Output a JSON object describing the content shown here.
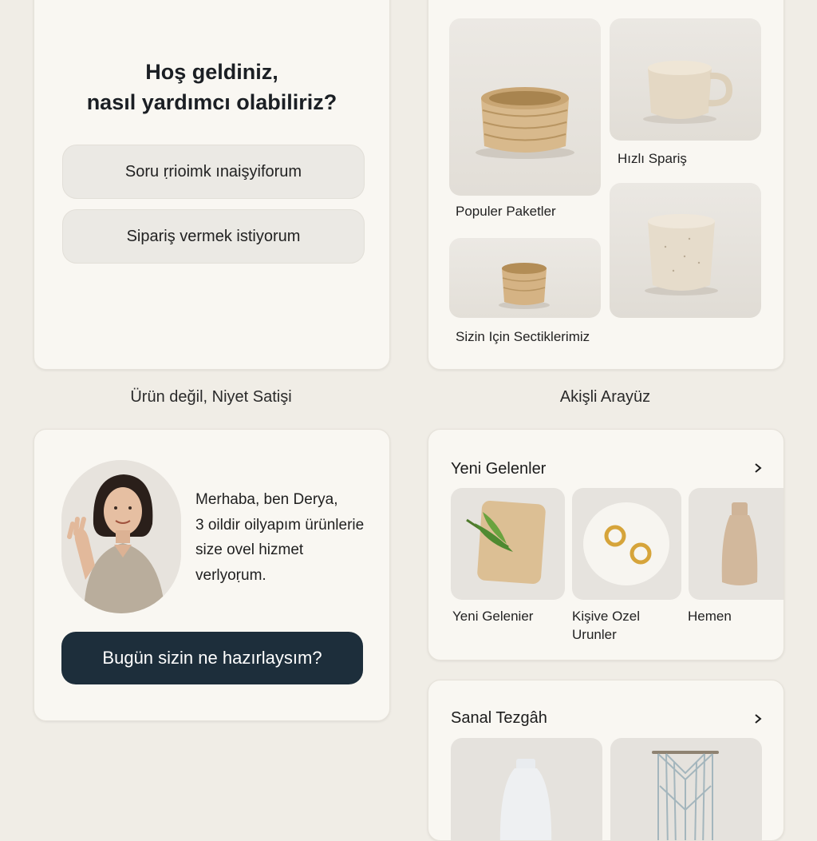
{
  "welcome": {
    "title_line1": "Hoş geldiniz,",
    "title_line2": "nasıl yardımcı olabiliriz?",
    "options": [
      "Soru ṛrioimk ınaişyiforum",
      "Sipariş vermek istiyorum"
    ]
  },
  "flow": {
    "tiles": [
      {
        "label": "Populer Paketler",
        "icon": "woven-basket"
      },
      {
        "label": "Hızlı Spariş",
        "icon": "ceramic-mug"
      },
      {
        "label": "Sizin Için Sectiklerimiz",
        "icon": "small-basket"
      },
      {
        "label": "",
        "icon": "ceramic-cup"
      }
    ]
  },
  "captions": {
    "left": "Ürün değil, Niyet Satişi",
    "right": "Akişli Arayüz"
  },
  "intro": {
    "lines": [
      "Merhaba, ben Derya,",
      "3 oildir oilyapım ürünlerie",
      "size ovel hizmet",
      "verlyoṛum."
    ],
    "cta": "Bugün sizin ne hazırlaysım?",
    "avatar_icon": "person-waving"
  },
  "new_arrivals": {
    "title": "Yeni Gelenler",
    "items": [
      {
        "label": "Yeni Gelenier",
        "icon": "cutting-board"
      },
      {
        "label_line1": "Kişive Ozel",
        "label_line2": "Urunler",
        "icon": "gold-rings"
      },
      {
        "label": "Hemen",
        "icon": "vase"
      }
    ]
  },
  "stall": {
    "title": "Sanal Tezgâh",
    "items": [
      {
        "icon": "white-vase"
      },
      {
        "icon": "macrame-hanging"
      }
    ]
  },
  "colors": {
    "background": "#f0ede6",
    "card": "#f9f7f2",
    "cta": "#1d2e3b"
  }
}
